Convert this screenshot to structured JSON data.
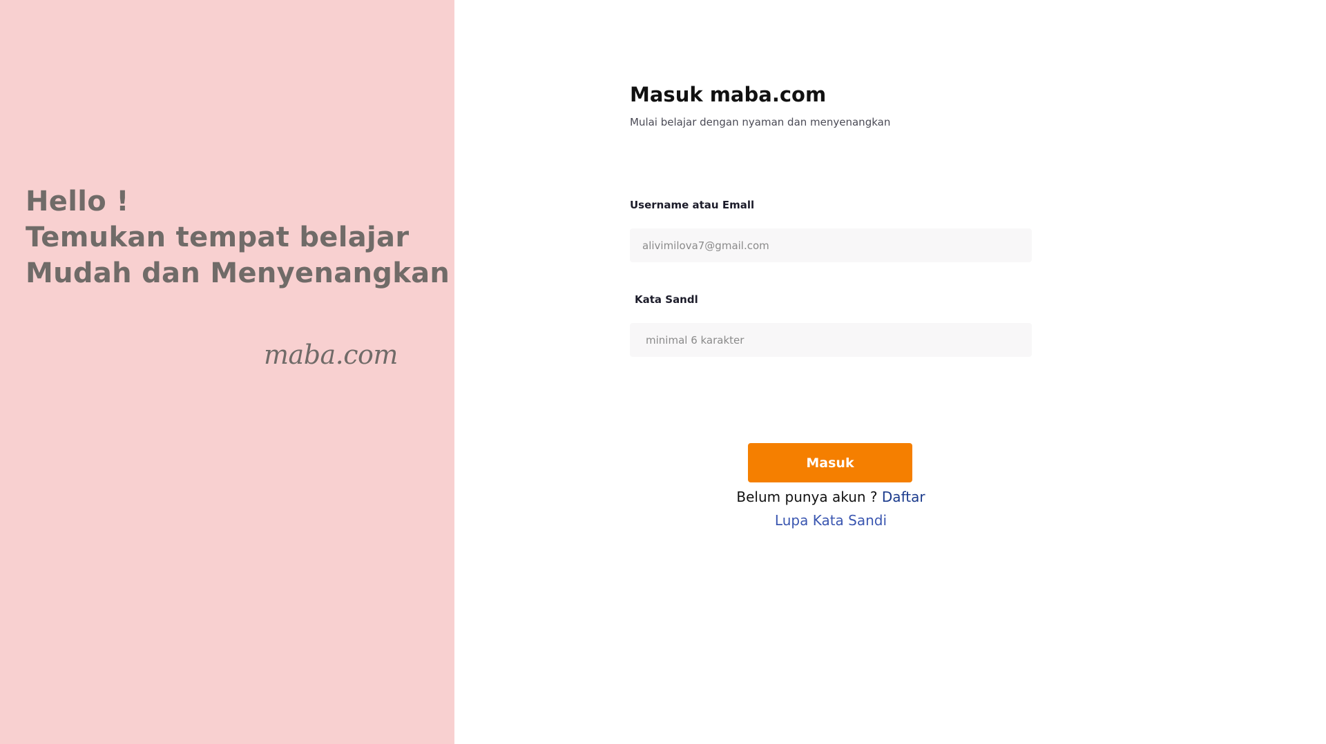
{
  "hero": {
    "line1": "Hello !",
    "line2": "Temukan tempat belajar",
    "line3": "Mudah dan Menyenangkan",
    "brand": "maba.com"
  },
  "form": {
    "title": "Masuk maba.com",
    "subtitle": "Mulai belajar dengan nyaman dan menyenangkan",
    "username_label": "Username atau Emall",
    "username_placeholder": "alivimilova7@gmail.com",
    "password_label": "Kata Sandl",
    "password_placeholder": "minimal 6 karakter",
    "submit_label": "Masuk",
    "register_prompt": "Belum punya akun ? ",
    "register_link": "Daftar",
    "forgot_link": "Lupa Kata Sandi"
  },
  "colors": {
    "left_panel_bg": "#f8d0d0",
    "hero_text": "#706b68",
    "submit_bg": "#f57f00",
    "link": "#1a3a8c",
    "input_bg": "#f8f7f8"
  }
}
